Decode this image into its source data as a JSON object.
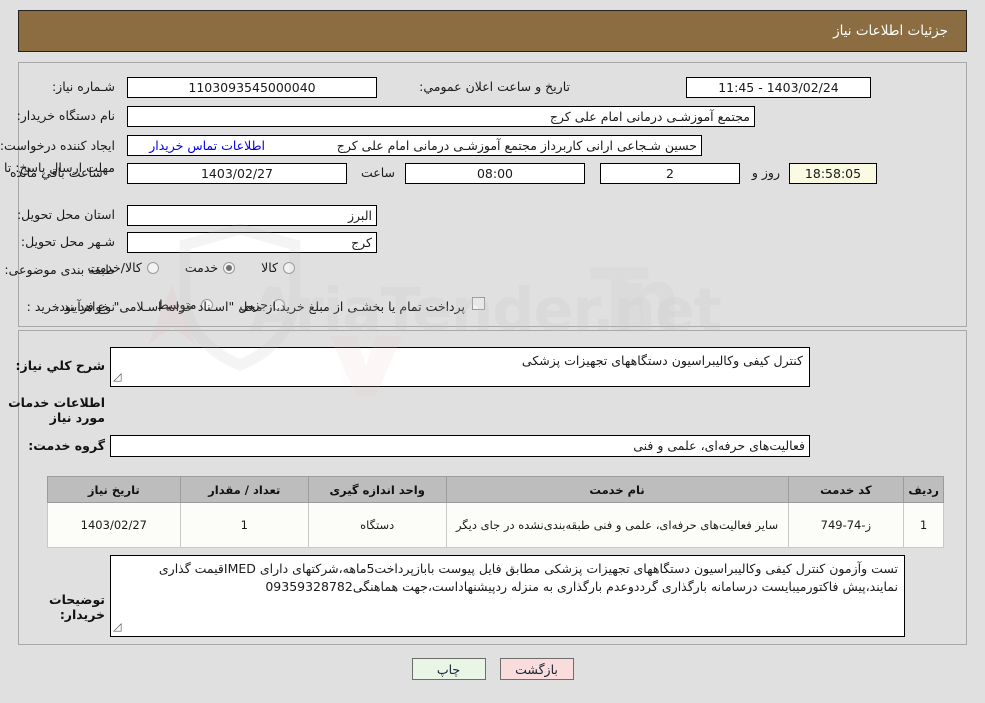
{
  "header": {
    "title": "جزئیات اطلاعات نیاز"
  },
  "colors": {
    "header_bg": "#8c6d42",
    "page_bg": "#e0e0e0",
    "link": "#0000ee",
    "timer_bg": "#fbfbe4",
    "print_btn_bg": "#e9f6e6",
    "back_btn_bg": "#fbdcdc"
  },
  "form": {
    "need_number_label": "شـماره نیاز:",
    "need_number_value": "1103093545000040",
    "announce_datetime_label": "تاریخ و ساعت اعلان عمومي:",
    "announce_datetime_value": "1403/02/24 - 11:45",
    "buyer_org_label": "نام دستگاه خریدار:",
    "buyer_org_value": "مجتمع آموزشـی درمانی امام علی کرج",
    "creator_label": "ایجاد کننده درخواست:",
    "creator_value": "حسین شـجاعی ارانی کاربرداز مجتمع آموزشـی درمانی امام علی کرج",
    "contact_link": "اطلاعات تماس خریدار",
    "deadline_label": "مهلت ارسال پاسخ: تا تاریخ:",
    "deadline_date": "1403/02/27",
    "hour_label": "ساعت",
    "deadline_time": "08:00",
    "days_value": "2",
    "days_label": "روز و",
    "timer_value": "18:58:05",
    "timer_label": "ساعت باقي مانده",
    "province_label": "استان محل تحویل:",
    "province_value": "البرز",
    "city_label": "شـهر محل تحویل:",
    "city_value": "کرج",
    "category_label": "طبقه بندی موضوعی:",
    "category_options": [
      {
        "label": "کالا",
        "selected": false
      },
      {
        "label": "خدمت",
        "selected": true
      },
      {
        "label": "کالا/خدمت",
        "selected": false
      }
    ],
    "process_label": "نوع فرآیند خرید :",
    "process_options": [
      {
        "label": "جزیي",
        "selected": false
      },
      {
        "label": "متوسط",
        "selected": false
      }
    ],
    "treasury_checked": false,
    "treasury_note": "پرداخت تمام یا بخشـی از مبلغ خرید،از محل \"اسـناد خزانه اسـلامی\" خواهد بود."
  },
  "description": {
    "general_need_label": "شرح كلي نیاز:",
    "general_need_value": "کنترل کیفی وکالیبراسیون دستگاههای تجهیزات پزشکی",
    "services_info_title": "اطلاعات خدمات مورد نیاز",
    "service_group_label": "گروه خدمت:",
    "service_group_value": "فعالیت‌های حرفه‌ای، علمی و فنی"
  },
  "table": {
    "columns": [
      "ردیف",
      "کد خدمت",
      "نام خدمت",
      "واحد اندازه گیری",
      "تعداد / مقدار",
      "تاریخ نیاز"
    ],
    "rows": [
      {
        "row_no": "1",
        "service_code": "ز-74-749",
        "service_name": "سایر فعالیت‌های حرفه‌ای، علمی و فنی طبقه‌بندی‌نشده در جای دیگر",
        "unit": "دستگاه",
        "quantity": "1",
        "need_date": "1403/02/27"
      }
    ]
  },
  "buyer_notes": {
    "label": "توضیحات خریدار:",
    "value": "تست وآزمون کنترل کیفی وکالیبراسیون دستگاههای تجهیزات پزشکی مطابق فایل پیوست بابازپرداخت5ماهه،شرکتهای دارای IMEDقیمت گذاری نمایند،پیش فاکتورمیبایست درسامانه بارگذاری گرددوعدم بارگذاری به منزله ردپیشنهاداست،جهت هماهنگی09359328782"
  },
  "buttons": {
    "print": "چاپ",
    "back": "بازگشت"
  }
}
